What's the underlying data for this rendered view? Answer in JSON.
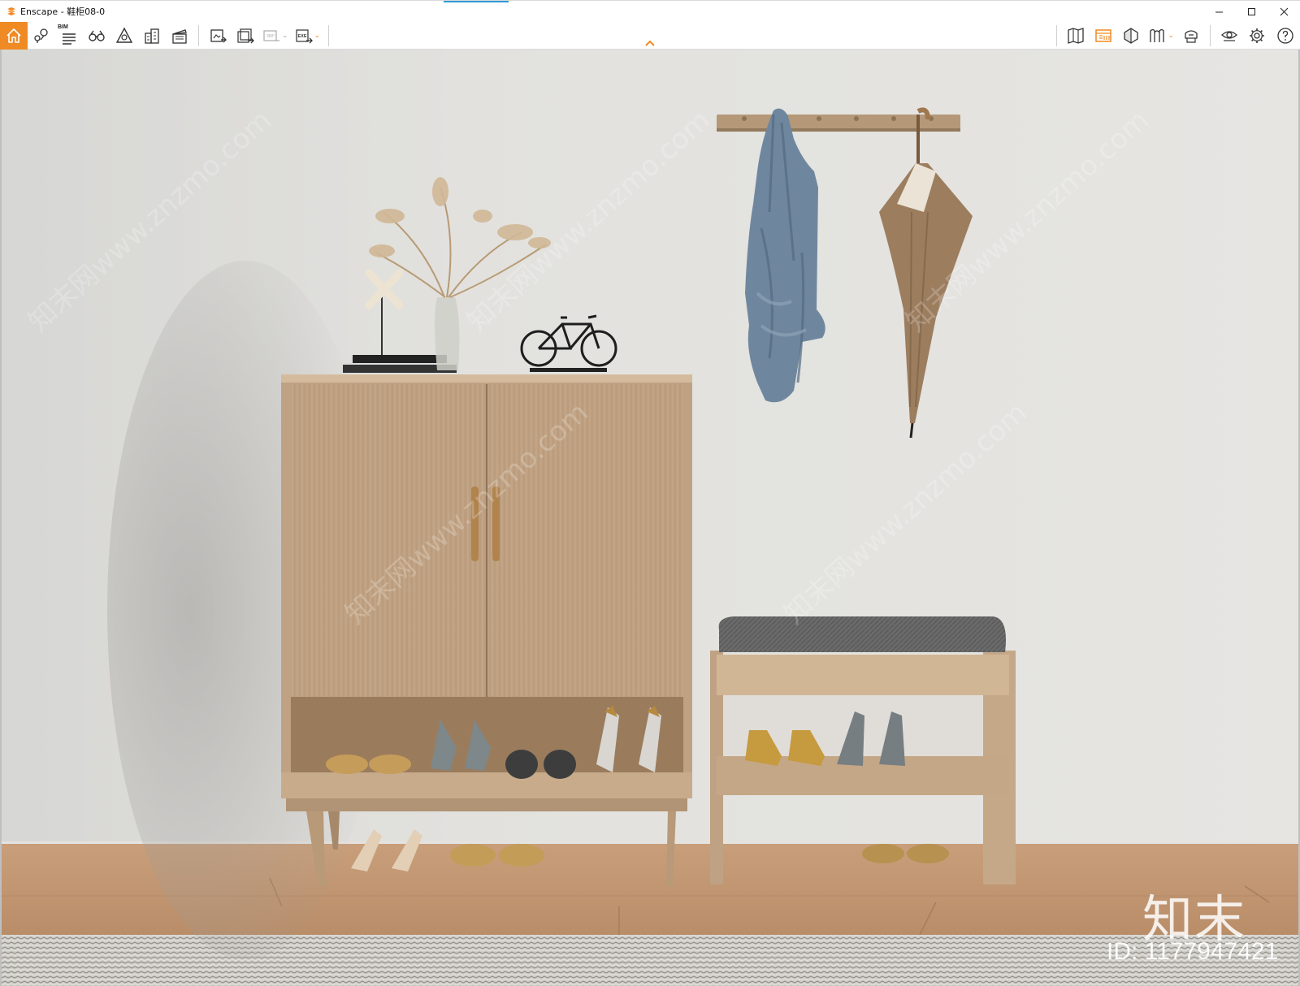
{
  "window": {
    "title": "Enscape - 鞋柜08-0",
    "app_icon": "enscape-logo-icon",
    "controls": [
      "minimize-icon",
      "maximize-icon",
      "close-icon"
    ]
  },
  "toolbar": {
    "left_tools": [
      {
        "name": "home",
        "icon": "home-icon",
        "active": true
      },
      {
        "name": "map-pin",
        "icon": "map-pin-icon"
      },
      {
        "name": "bim",
        "icon": "bim-info-icon",
        "label": "BIM"
      },
      {
        "name": "binoculars",
        "icon": "binoculars-icon"
      },
      {
        "name": "section",
        "icon": "section-icon"
      },
      {
        "name": "buildings",
        "icon": "buildings-icon"
      },
      {
        "name": "clapperboard",
        "icon": "clapperboard-icon"
      }
    ],
    "export_tools": [
      {
        "name": "screenshot",
        "icon": "screenshot-icon"
      },
      {
        "name": "batch-render",
        "icon": "batch-render-icon"
      },
      {
        "name": "panorama",
        "icon": "panorama-360-icon",
        "disabled": true
      },
      {
        "name": "export-exe",
        "icon": "exe-export-icon"
      }
    ],
    "right_tools": [
      {
        "name": "minimap",
        "icon": "minimap-icon"
      },
      {
        "name": "material-editor",
        "icon": "material-editor-icon",
        "active": true
      },
      {
        "name": "asset-library",
        "icon": "asset-library-icon"
      },
      {
        "name": "views",
        "icon": "views-icon"
      },
      {
        "name": "vr",
        "icon": "vr-headset-icon"
      },
      {
        "name": "visual-settings",
        "icon": "eye-settings-icon"
      },
      {
        "name": "settings",
        "icon": "gear-icon"
      },
      {
        "name": "help",
        "icon": "help-icon"
      }
    ],
    "accent": "#f08a24"
  },
  "scene": {
    "watermark_brand": "知末",
    "watermark_id": "ID: 1177947421",
    "watermark_diagonal": "知末网www.znzmo.com"
  }
}
